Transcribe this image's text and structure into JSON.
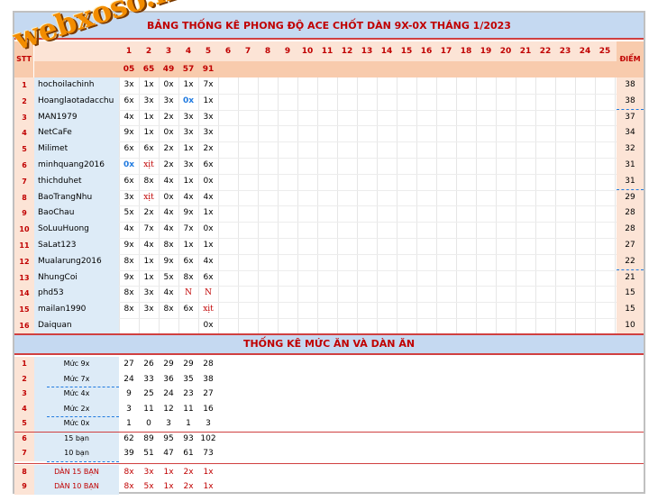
{
  "title": "BẢNG THỐNG KÊ PHONG ĐỘ ACE CHỐT DÀN 9X-0X THÁNG 1/2023",
  "watermark": "webxoso.net",
  "header": {
    "stt": "STT",
    "diem": "ĐIỂM",
    "days": [
      "1",
      "2",
      "3",
      "4",
      "5",
      "6",
      "7",
      "8",
      "9",
      "10",
      "11",
      "12",
      "13",
      "14",
      "15",
      "16",
      "17",
      "18",
      "19",
      "20",
      "21",
      "22",
      "23",
      "24",
      "25"
    ],
    "results": [
      "05",
      "65",
      "49",
      "57",
      "91"
    ]
  },
  "players": [
    {
      "stt": "1",
      "name": "hochoilachinh",
      "cells": [
        "3x",
        "1x",
        "0x",
        "1x",
        "7x"
      ],
      "points": "38"
    },
    {
      "stt": "2",
      "name": "Hoanglaotadacchu",
      "cells": [
        "6x",
        "3x",
        "3x",
        "0x",
        "1x"
      ],
      "points": "38"
    },
    {
      "stt": "3",
      "name": "MAN1979",
      "cells": [
        "4x",
        "1x",
        "2x",
        "3x",
        "3x"
      ],
      "points": "37"
    },
    {
      "stt": "4",
      "name": "NetCaFe",
      "cells": [
        "9x",
        "1x",
        "0x",
        "3x",
        "3x"
      ],
      "points": "34"
    },
    {
      "stt": "5",
      "name": "Milimet",
      "cells": [
        "6x",
        "6x",
        "2x",
        "1x",
        "2x"
      ],
      "points": "32"
    },
    {
      "stt": "6",
      "name": "minhquang2016",
      "cells": [
        "0x",
        "xịt",
        "2x",
        "3x",
        "6x"
      ],
      "points": "31"
    },
    {
      "stt": "7",
      "name": "thichduhet",
      "cells": [
        "6x",
        "8x",
        "4x",
        "1x",
        "0x"
      ],
      "points": "31"
    },
    {
      "stt": "8",
      "name": "BaoTrangNhu",
      "cells": [
        "3x",
        "xịt",
        "0x",
        "4x",
        "4x"
      ],
      "points": "29"
    },
    {
      "stt": "9",
      "name": "BaoChau",
      "cells": [
        "5x",
        "2x",
        "4x",
        "9x",
        "1x"
      ],
      "points": "28"
    },
    {
      "stt": "10",
      "name": "SoLuuHuong",
      "cells": [
        "4x",
        "7x",
        "4x",
        "7x",
        "0x"
      ],
      "points": "28"
    },
    {
      "stt": "11",
      "name": "SaLat123",
      "cells": [
        "9x",
        "4x",
        "8x",
        "1x",
        "1x"
      ],
      "points": "27"
    },
    {
      "stt": "12",
      "name": "Mualarung2016",
      "cells": [
        "8x",
        "1x",
        "9x",
        "6x",
        "4x"
      ],
      "points": "22"
    },
    {
      "stt": "13",
      "name": "NhungCoi",
      "cells": [
        "9x",
        "1x",
        "5x",
        "8x",
        "6x"
      ],
      "points": "21"
    },
    {
      "stt": "14",
      "name": "phd53",
      "cells": [
        "8x",
        "3x",
        "4x",
        "N",
        "N"
      ],
      "points": "15"
    },
    {
      "stt": "15",
      "name": "mailan1990",
      "cells": [
        "8x",
        "3x",
        "8x",
        "6x",
        "xịt"
      ],
      "points": "15"
    },
    {
      "stt": "16",
      "name": "Daiquan",
      "cells": [
        "",
        "",
        "",
        "",
        "0x"
      ],
      "points": "10"
    }
  ],
  "stats_title": "THỐNG KÊ MỨC ĂN VÀ DÀN ĂN",
  "stats": [
    {
      "stt": "1",
      "label": "Mức 9x",
      "values": [
        "27",
        "26",
        "29",
        "29",
        "28"
      ]
    },
    {
      "stt": "2",
      "label": "Mức 7x",
      "values": [
        "24",
        "33",
        "36",
        "35",
        "38"
      ]
    },
    {
      "stt": "3",
      "label": "Mức 4x",
      "values": [
        "9",
        "25",
        "24",
        "23",
        "27"
      ]
    },
    {
      "stt": "4",
      "label": "Mức 2x",
      "values": [
        "3",
        "11",
        "12",
        "11",
        "16"
      ]
    },
    {
      "stt": "5",
      "label": "Mức 0x",
      "values": [
        "1",
        "0",
        "3",
        "1",
        "3"
      ]
    },
    {
      "stt": "6",
      "label": "15 bạn",
      "values": [
        "62",
        "89",
        "95",
        "93",
        "102"
      ]
    },
    {
      "stt": "7",
      "label": "10 bạn",
      "values": [
        "39",
        "51",
        "47",
        "61",
        "73"
      ]
    },
    {
      "stt": "8",
      "label": "DÀN 15 BẠN",
      "values": [
        "8x",
        "3x",
        "1x",
        "2x",
        "1x"
      ]
    },
    {
      "stt": "9",
      "label": "DÀN 10 BẠN",
      "values": [
        "8x",
        "5x",
        "1x",
        "2x",
        "1x"
      ]
    }
  ],
  "colors": {
    "title_bg": "#c5d9f1",
    "header_bg": "#f8cbad",
    "accent_red": "#c00000",
    "name_bg": "#ddebf7",
    "blue_highlight": "#1f7ae0",
    "watermark": "#f28c00"
  }
}
